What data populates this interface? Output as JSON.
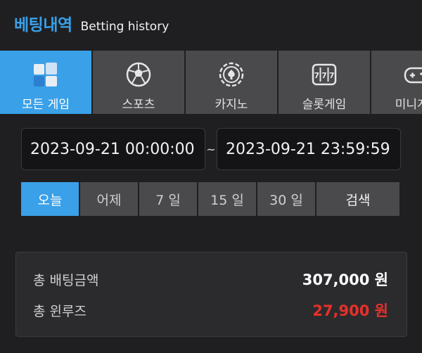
{
  "header": {
    "title_ko": "베팅내역",
    "title_en": "Betting history"
  },
  "tabs": [
    {
      "label": "모든 게임",
      "icon": "all-games-icon",
      "active": true
    },
    {
      "label": "스포츠",
      "icon": "soccer-ball-icon",
      "active": false
    },
    {
      "label": "카지노",
      "icon": "casino-chip-icon",
      "active": false
    },
    {
      "label": "슬롯게임",
      "icon": "slot-machine-icon",
      "active": false
    },
    {
      "label": "미니게임",
      "icon": "gamepad-icon",
      "active": false
    }
  ],
  "date_range": {
    "start": "2023-09-21 00:00:00",
    "end": "2023-09-21 23:59:59",
    "separator": "~"
  },
  "quick_ranges": {
    "today": "오늘",
    "yesterday": "어제",
    "d7": "7 일",
    "d15": "15 일",
    "d30": "30 일",
    "search": "검색"
  },
  "summary": {
    "total_bet_label": "총 배팅금액",
    "total_bet_value": "307,000 원",
    "total_winloss_label": "총 윈루즈",
    "total_winloss_value": "27,900 원"
  },
  "colors": {
    "accent": "#3aa0e8",
    "background": "#1f1f21",
    "tab_bg": "#4a4a4d",
    "loss_red": "#e8302a"
  }
}
